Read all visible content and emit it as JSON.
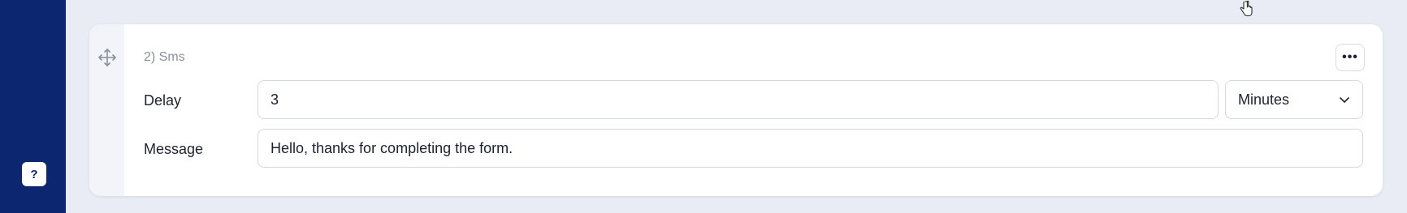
{
  "sidebar": {
    "help_icon": "question-mark-icon",
    "help_label": "?"
  },
  "step": {
    "title": "2) Sms",
    "more_label": "•••",
    "delay": {
      "label": "Delay",
      "value": "3",
      "unit": "Minutes",
      "unit_icon": "chevron-down-icon"
    },
    "message": {
      "label": "Message",
      "value": "Hello, thanks for completing the form."
    }
  },
  "icons": {
    "drag": "move-arrows-icon",
    "cursor": "hand-pointer-icon"
  },
  "colors": {
    "sidebar": "#0d2670",
    "page_background": "#e9ecf4",
    "card_background": "#ffffff"
  }
}
